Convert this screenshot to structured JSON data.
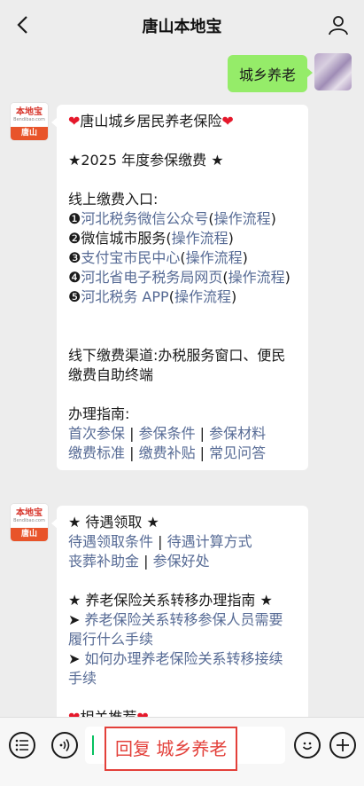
{
  "header": {
    "title": "唐山本地宝"
  },
  "sent": {
    "text": "城乡养老"
  },
  "bot": {
    "logo_brand": "本地宝",
    "logo_site": "Bendibao.com",
    "logo_city": "唐山"
  },
  "msg1": {
    "heading_text": "唐山城乡居民养老保险",
    "year_title": "★2025 年度参保缴费 ★",
    "online_label": "线上缴费入口:",
    "items": [
      {
        "num": "❶",
        "link": "河北税务微信公众号",
        "open": "(",
        "flow": "操作流程",
        "close": ")"
      },
      {
        "num": "❷",
        "text": "微信城市服务",
        "open": "(",
        "flow": "操作流程",
        "close": ")"
      },
      {
        "num": "❸",
        "link": "支付宝市民中心",
        "open": "(",
        "flow": "操作流程",
        "close": ")"
      },
      {
        "num": "❹",
        "link": "河北省电子税务局网页",
        "open": "(",
        "flow": "操作流程",
        "close": ")"
      },
      {
        "num": "❺",
        "link": "河北税务 APP",
        "open": "(",
        "flow": "操作流程",
        "close": ")"
      }
    ],
    "offline_text": "线下缴费渠道:办税服务窗口、便民缴费自助终端",
    "guide_label": "办理指南:",
    "guide_links": [
      "首次参保",
      "参保条件",
      "参保材料",
      "缴费标准",
      "缴费补贴",
      "常见问答"
    ]
  },
  "msg2": {
    "benefit_title": "★ 待遇领取 ★",
    "benefit_links": [
      "待遇领取条件",
      "待遇计算方式",
      "丧葬补助金",
      "参保好处"
    ],
    "transfer_title": "★ 养老保险关系转移办理指南 ★",
    "transfer_arrow": "➤",
    "transfer_links": [
      "养老保险关系转移参保人员需要履行什么手续",
      "如何办理养老保险关系转移接续手续"
    ],
    "partial_text": "相关推荐"
  },
  "input": {
    "reply_tag": "回复 城乡养老"
  }
}
